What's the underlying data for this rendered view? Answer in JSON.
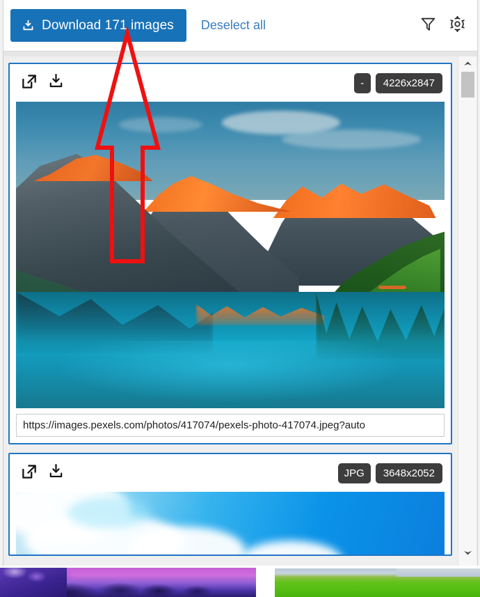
{
  "toolbar": {
    "download_label": "Download 171 images",
    "download_icon": "download-tray-icon",
    "deselect_label": "Deselect all",
    "filter_icon": "filter-funnel-icon",
    "settings_icon": "gear-icon",
    "accent_color": "#1872b8",
    "link_color": "#3a7cbd"
  },
  "cards": [
    {
      "open_icon": "external-link-icon",
      "download_icon": "download-tray-icon",
      "format_badge": "-",
      "size_badge": "4226x2847",
      "url": "https://images.pexels.com/photos/417074/pexels-photo-417074.jpeg?auto",
      "image_alt": "mountain-lake-photo",
      "selected_border_color": "#1f76c6"
    },
    {
      "open_icon": "external-link-icon",
      "download_icon": "download-tray-icon",
      "format_badge": "JPG",
      "size_badge": "3648x2052",
      "image_alt": "blue-sky-clouds-photo",
      "selected_border_color": "#1f76c6"
    }
  ],
  "scrollbar": {
    "up_icon": "chevron-up-icon",
    "down_icon": "chevron-down-icon",
    "thumb": "scroll-thumb"
  },
  "annotation": {
    "shape": "red-arrow-up",
    "color": "#ee1111",
    "points_to": "Download 171 images"
  }
}
